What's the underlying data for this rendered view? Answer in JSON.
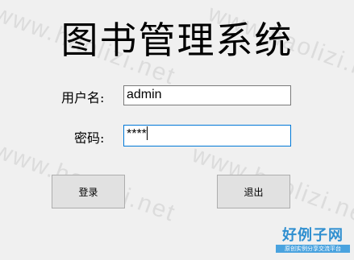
{
  "watermarks": [
    "www.haolizi.net",
    "www.haolizi.net",
    "www.haolizi.net",
    "www.haolizi.net"
  ],
  "title": "图书管理系统",
  "form": {
    "username_label": "用户名:",
    "username_value": "admin",
    "password_label": "密码:",
    "password_value": "****"
  },
  "buttons": {
    "login": "登录",
    "exit": "退出"
  },
  "brand": {
    "main": "好例子网",
    "sub": "原创实例分享交流平台"
  }
}
